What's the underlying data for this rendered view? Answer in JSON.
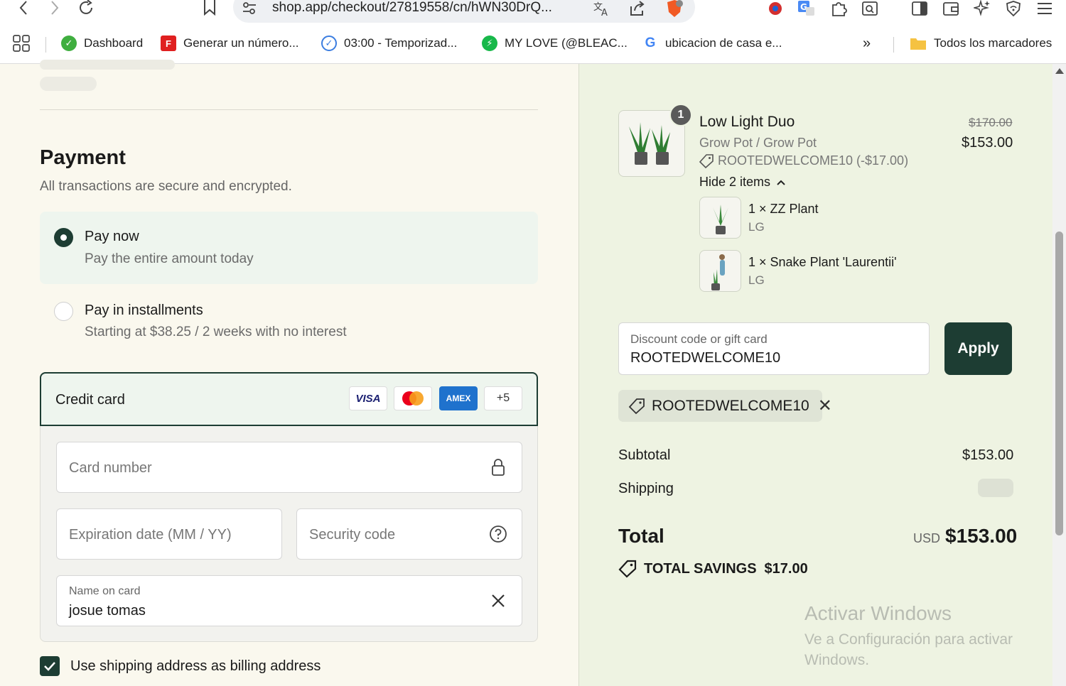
{
  "browser": {
    "url": "shop.app/checkout/27819558/cn/hWN30DrQ...",
    "bookmarks": [
      {
        "label": "Dashboard"
      },
      {
        "label": "Generar un número..."
      },
      {
        "label": "03:00 - Temporizad..."
      },
      {
        "label": "MY LOVE (@BLEAC..."
      },
      {
        "label": "ubicacion de casa e..."
      }
    ],
    "more_label": "»",
    "all_bookmarks": "Todos los marcadores"
  },
  "payment": {
    "title": "Payment",
    "subtitle": "All transactions are secure and encrypted.",
    "options": [
      {
        "title": "Pay now",
        "subtitle": "Pay the entire amount today",
        "selected": true
      },
      {
        "title": "Pay in installments",
        "subtitle": "Starting at $38.25 / 2 weeks with no interest",
        "selected": false
      }
    ],
    "credit_card": {
      "label": "Credit card",
      "brands": [
        "VISA",
        "AMEX",
        "+5"
      ],
      "card_number_placeholder": "Card number",
      "expiration_placeholder": "Expiration date (MM / YY)",
      "security_placeholder": "Security code",
      "name_label": "Name on card",
      "name_value": "josue tomas"
    },
    "billing_checkbox_label": "Use shipping address as billing address",
    "billing_checked": true
  },
  "order": {
    "quantity_badge": "1",
    "product_title": "Low Light Duo",
    "variant": "Grow Pot / Grow Pot",
    "discount_line": "ROOTEDWELCOME10 (-$17.00)",
    "original_price": "$170.00",
    "price": "$153.00",
    "hide_items": "Hide 2 items",
    "items": [
      {
        "name": "1 × ZZ Plant",
        "size": "LG"
      },
      {
        "name": "1 × Snake Plant 'Laurentii'",
        "size": "LG"
      }
    ],
    "discount_field_label": "Discount code or gift card",
    "discount_field_value": "ROOTEDWELCOME10",
    "apply_label": "Apply",
    "applied_code": "ROOTEDWELCOME10",
    "subtotal_label": "Subtotal",
    "subtotal_value": "$153.00",
    "shipping_label": "Shipping",
    "total_label": "Total",
    "currency": "USD",
    "total_value": "$153.00",
    "savings_label": "TOTAL SAVINGS",
    "savings_value": "$17.00"
  },
  "watermark": {
    "title": "Activar Windows",
    "subtitle": "Ve a Configuración para activar Windows."
  },
  "colors": {
    "accent": "#1d3d33",
    "left_bg": "#faf8ee",
    "right_bg": "#eef3e2"
  }
}
